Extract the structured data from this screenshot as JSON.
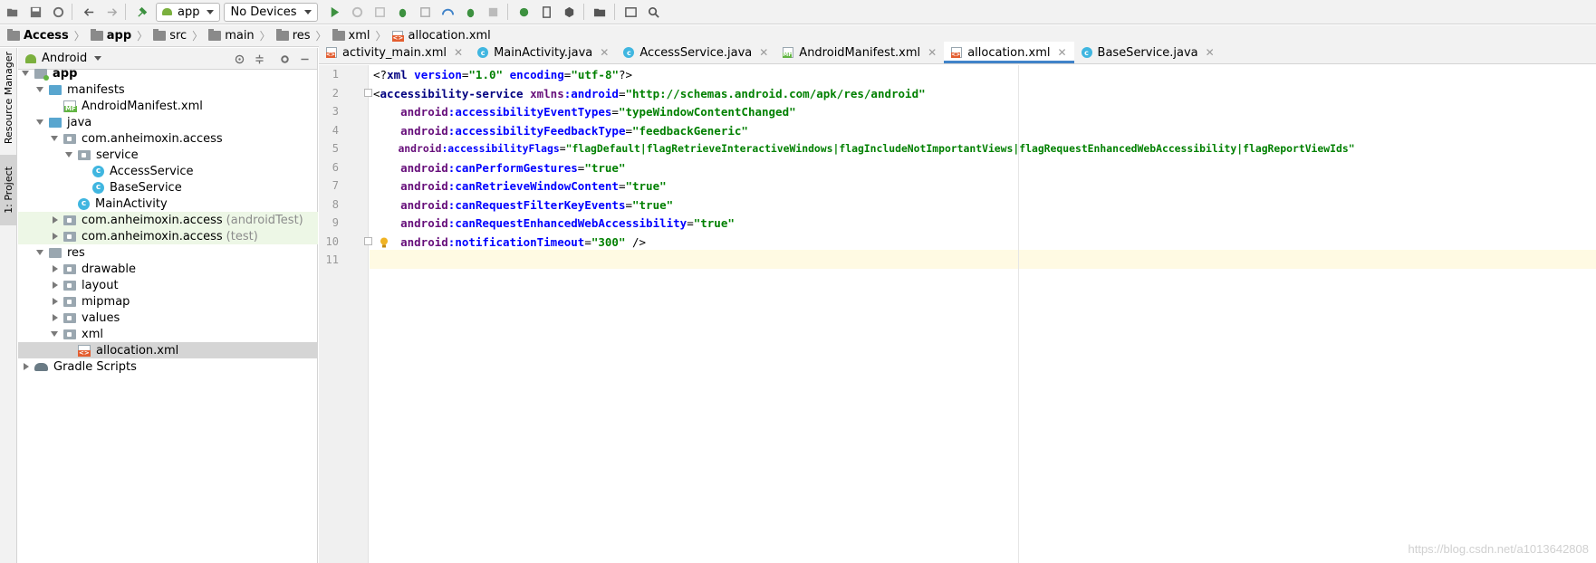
{
  "toolbar": {
    "run_config": "app",
    "device": "No Devices"
  },
  "breadcrumb": [
    "Access",
    "app",
    "src",
    "main",
    "res",
    "xml",
    "allocation.xml"
  ],
  "sidestrip": {
    "resource_manager": "Resource Manager",
    "project": "1: Project"
  },
  "project_panel": {
    "view_mode": "Android",
    "tree": [
      {
        "label": "app",
        "suffix": ""
      },
      {
        "label": "manifests",
        "suffix": ""
      },
      {
        "label": "AndroidManifest.xml",
        "suffix": ""
      },
      {
        "label": "java",
        "suffix": ""
      },
      {
        "label": "com.anheimoxin.access",
        "suffix": ""
      },
      {
        "label": "service",
        "suffix": ""
      },
      {
        "label": "AccessService",
        "suffix": ""
      },
      {
        "label": "BaseService",
        "suffix": ""
      },
      {
        "label": "MainActivity",
        "suffix": ""
      },
      {
        "label": "com.anheimoxin.access",
        "suffix": "(androidTest)"
      },
      {
        "label": "com.anheimoxin.access",
        "suffix": "(test)"
      },
      {
        "label": "res",
        "suffix": ""
      },
      {
        "label": "drawable",
        "suffix": ""
      },
      {
        "label": "layout",
        "suffix": ""
      },
      {
        "label": "mipmap",
        "suffix": ""
      },
      {
        "label": "values",
        "suffix": ""
      },
      {
        "label": "xml",
        "suffix": ""
      },
      {
        "label": "allocation.xml",
        "suffix": ""
      },
      {
        "label": "Gradle Scripts",
        "suffix": ""
      }
    ]
  },
  "tabs": [
    {
      "label": "activity_main.xml",
      "icon": "xml-file-icon"
    },
    {
      "label": "MainActivity.java",
      "icon": "java-class-icon"
    },
    {
      "label": "AccessService.java",
      "icon": "java-class-icon"
    },
    {
      "label": "AndroidManifest.xml",
      "icon": "manifest-file-icon"
    },
    {
      "label": "allocation.xml",
      "icon": "xml-file-icon"
    },
    {
      "label": "BaseService.java",
      "icon": "java-class-icon"
    }
  ],
  "editor": {
    "line_numbers": [
      "1",
      "2",
      "3",
      "4",
      "5",
      "6",
      "7",
      "8",
      "9",
      "10",
      "11"
    ],
    "lines": [
      "<?xml version=\"1.0\" encoding=\"utf-8\"?>",
      "<accessibility-service xmlns:android=\"http://schemas.android.com/apk/res/android\"",
      "    android:accessibilityEventTypes=\"typeWindowContentChanged\"",
      "    android:accessibilityFeedbackType=\"feedbackGeneric\"",
      "    android:accessibilityFlags=\"flagDefault|flagRetrieveInteractiveWindows|flagIncludeNotImportantViews|flagRequestEnhancedWebAccessibility|flagReportViewIds\"",
      "    android:canPerformGestures=\"true\"",
      "    android:canRetrieveWindowContent=\"true\"",
      "    android:canRequestFilterKeyEvents=\"true\"",
      "    android:canRequestEnhancedWebAccessibility=\"true\"",
      "    android:notificationTimeout=\"300\" />",
      ""
    ]
  },
  "watermark": "https://blog.csdn.net/a1013642808"
}
